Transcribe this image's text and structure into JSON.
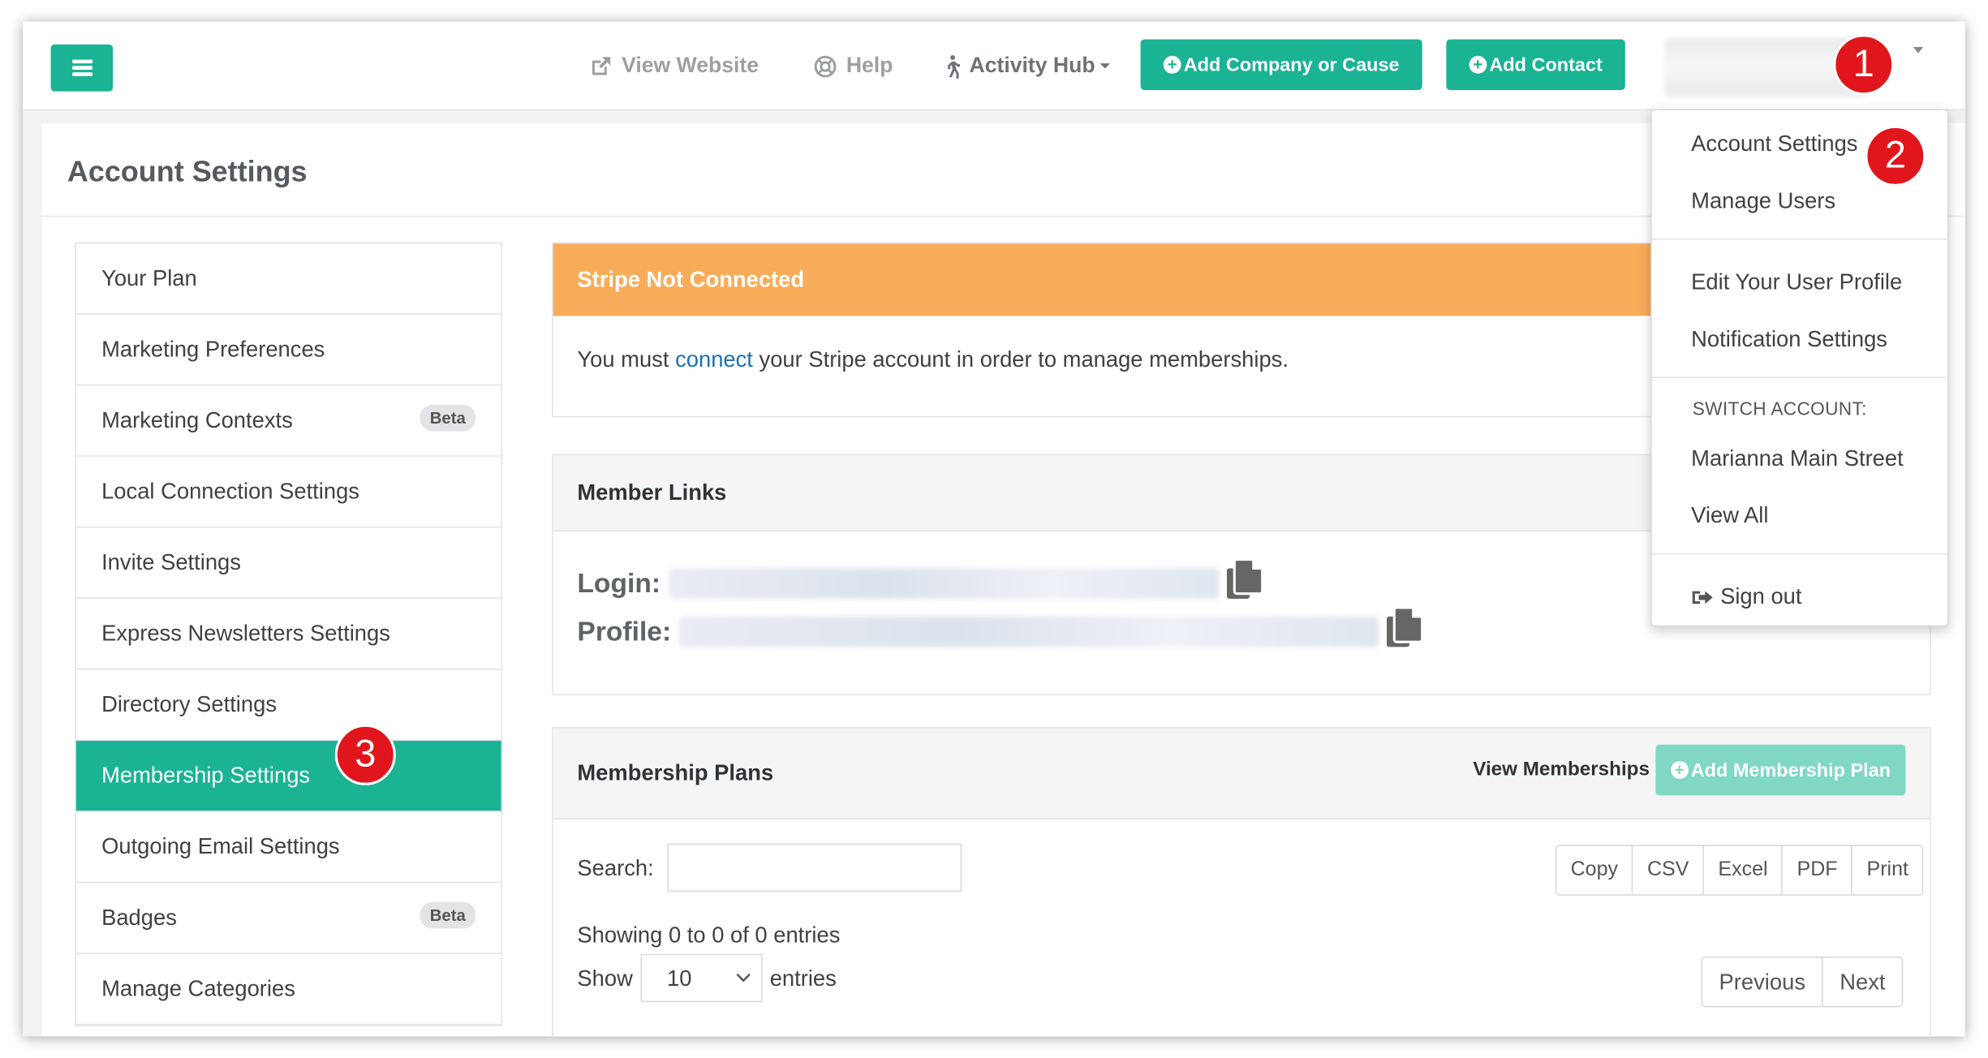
{
  "header": {
    "view_website": "View Website",
    "help": "Help",
    "activity_hub": "Activity Hub",
    "add_company": "Add Company or Cause",
    "add_contact": "Add Contact"
  },
  "markers": [
    "1",
    "2",
    "3"
  ],
  "page": {
    "title": "Account Settings"
  },
  "sidebar": {
    "items": [
      {
        "label": "Your Plan",
        "badge": ""
      },
      {
        "label": "Marketing Preferences",
        "badge": ""
      },
      {
        "label": "Marketing Contexts",
        "badge": "Beta"
      },
      {
        "label": "Local Connection Settings",
        "badge": ""
      },
      {
        "label": "Invite Settings",
        "badge": ""
      },
      {
        "label": "Express Newsletters Settings",
        "badge": ""
      },
      {
        "label": "Directory Settings",
        "badge": ""
      },
      {
        "label": "Membership Settings",
        "badge": ""
      },
      {
        "label": "Outgoing Email Settings",
        "badge": ""
      },
      {
        "label": "Badges",
        "badge": "Beta"
      },
      {
        "label": "Manage Categories",
        "badge": ""
      }
    ]
  },
  "stripe": {
    "title": "Stripe Not Connected",
    "text_before": "You must ",
    "link": "connect",
    "text_after": " your Stripe account in order to manage memberships."
  },
  "member_links": {
    "title": "Member Links",
    "login_label": "Login:",
    "profile_label": "Profile:"
  },
  "plans": {
    "title": "Membership Plans",
    "view_memberships": "View Memberships",
    "add_plan": "Add Membership Plan",
    "search_label": "Search:",
    "search_value": "",
    "export_buttons": [
      "Copy",
      "CSV",
      "Excel",
      "PDF",
      "Print"
    ],
    "showing": "Showing 0 to 0 of 0 entries",
    "show_label": "Show",
    "show_value": "10",
    "entries_label": "entries",
    "previous": "Previous",
    "next": "Next"
  },
  "dropdown": {
    "account_settings": "Account Settings",
    "manage_users": "Manage Users",
    "edit_profile": "Edit Your User Profile",
    "notification_settings": "Notification Settings",
    "switch_account": "SWITCH ACCOUNT:",
    "account_name": "Marianna Main Street",
    "view_all": "View All",
    "sign_out": "Sign out"
  },
  "colors": {
    "accent": "#1ab394",
    "warning": "#f8ac59",
    "marker": "#e0161c",
    "link": "#1c6fb3"
  }
}
